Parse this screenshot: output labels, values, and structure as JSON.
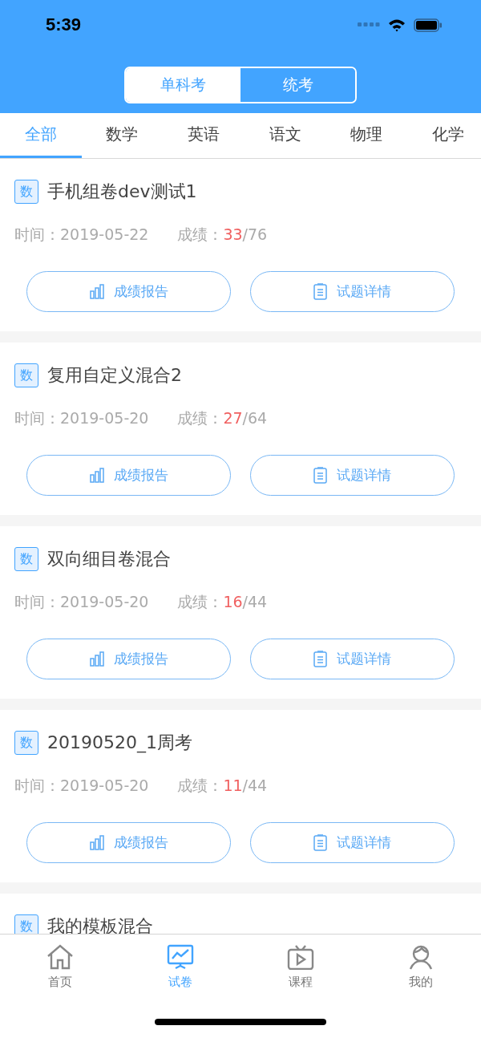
{
  "status_bar": {
    "time": "5:39"
  },
  "segments": [
    {
      "label": "单科考",
      "selected": false
    },
    {
      "label": "统考",
      "selected": true
    }
  ],
  "subject_tabs": [
    {
      "label": "全部",
      "selected": true
    },
    {
      "label": "数学",
      "selected": false
    },
    {
      "label": "英语",
      "selected": false
    },
    {
      "label": "语文",
      "selected": false
    },
    {
      "label": "物理",
      "selected": false
    },
    {
      "label": "化学",
      "selected": false
    }
  ],
  "exams": [
    {
      "badge": "数",
      "title": "手机组卷dev测试1",
      "time": "时间：2019-05-22",
      "score_label": "成绩：",
      "score": "33",
      "total": "/76",
      "buttons": [
        "成绩报告",
        "试题详情"
      ]
    },
    {
      "badge": "数",
      "title": "复用自定义混合2",
      "time": "时间：2019-05-20",
      "score_label": "成绩：",
      "score": "27",
      "total": "/64",
      "buttons": [
        "成绩报告",
        "试题详情"
      ]
    },
    {
      "badge": "数",
      "title": "双向细目卷混合",
      "time": "时间：2019-05-20",
      "score_label": "成绩：",
      "score": "16",
      "total": "/44",
      "buttons": [
        "成绩报告",
        "试题详情"
      ]
    },
    {
      "badge": "数",
      "title": "20190520_1周考",
      "time": "时间：2019-05-20",
      "score_label": "成绩：",
      "score": "11",
      "total": "/44",
      "buttons": [
        "成绩报告",
        "试题详情"
      ]
    },
    {
      "badge": "数",
      "title": "我的模板混合"
    }
  ],
  "nav": [
    {
      "label": "首页",
      "selected": false
    },
    {
      "label": "试卷",
      "selected": true
    },
    {
      "label": "课程",
      "selected": false
    },
    {
      "label": "我的",
      "selected": false
    }
  ]
}
